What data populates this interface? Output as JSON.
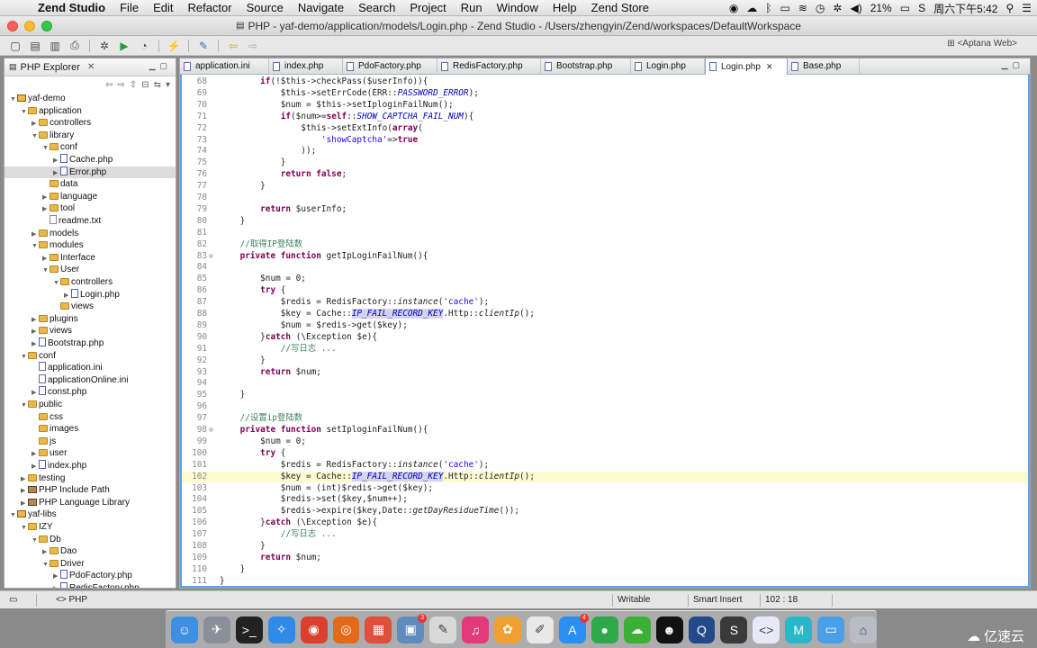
{
  "menubar": {
    "app": "Zend Studio",
    "items": [
      "File",
      "Edit",
      "Refactor",
      "Source",
      "Navigate",
      "Search",
      "Project",
      "Run",
      "Window",
      "Help",
      "Zend Store"
    ],
    "battery": "21%",
    "clock": "周六下午5:42"
  },
  "window": {
    "title": "PHP - yaf-demo/application/models/Login.php - Zend Studio - /Users/zhengyin/Zend/workspaces/DefaultWorkspace"
  },
  "toolbar": {
    "perspective": "<Aptana Web>"
  },
  "explorer": {
    "title": "PHP Explorer",
    "tree": [
      {
        "label": "yaf-demo",
        "depth": 0,
        "icon": "proj",
        "open": true
      },
      {
        "label": "application",
        "depth": 1,
        "icon": "folder",
        "open": true
      },
      {
        "label": "controllers",
        "depth": 2,
        "icon": "folder",
        "open": false
      },
      {
        "label": "library",
        "depth": 2,
        "icon": "folder",
        "open": true
      },
      {
        "label": "conf",
        "depth": 3,
        "icon": "folder",
        "open": true
      },
      {
        "label": "Cache.php",
        "depth": 4,
        "icon": "php",
        "open": false
      },
      {
        "label": "Error.php",
        "depth": 4,
        "icon": "php",
        "open": false,
        "selected": true
      },
      {
        "label": "data",
        "depth": 3,
        "icon": "folder",
        "open": null
      },
      {
        "label": "language",
        "depth": 3,
        "icon": "folder",
        "open": false
      },
      {
        "label": "tool",
        "depth": 3,
        "icon": "folder",
        "open": false
      },
      {
        "label": "readme.txt",
        "depth": 3,
        "icon": "txt",
        "open": null
      },
      {
        "label": "models",
        "depth": 2,
        "icon": "folder",
        "open": false
      },
      {
        "label": "modules",
        "depth": 2,
        "icon": "folder",
        "open": true
      },
      {
        "label": "Interface",
        "depth": 3,
        "icon": "folder",
        "open": false
      },
      {
        "label": "User",
        "depth": 3,
        "icon": "folder",
        "open": true
      },
      {
        "label": "controllers",
        "depth": 4,
        "icon": "folder",
        "open": true
      },
      {
        "label": "Login.php",
        "depth": 5,
        "icon": "php",
        "open": false
      },
      {
        "label": "views",
        "depth": 4,
        "icon": "folder",
        "open": null
      },
      {
        "label": "plugins",
        "depth": 2,
        "icon": "folder",
        "open": false
      },
      {
        "label": "views",
        "depth": 2,
        "icon": "folder",
        "open": false
      },
      {
        "label": "Bootstrap.php",
        "depth": 2,
        "icon": "php",
        "open": false
      },
      {
        "label": "conf",
        "depth": 1,
        "icon": "folder",
        "open": true
      },
      {
        "label": "application.ini",
        "depth": 2,
        "icon": "file",
        "open": null
      },
      {
        "label": "applicationOnline.ini",
        "depth": 2,
        "icon": "file",
        "open": null
      },
      {
        "label": "const.php",
        "depth": 2,
        "icon": "php",
        "open": false
      },
      {
        "label": "public",
        "depth": 1,
        "icon": "folder",
        "open": true
      },
      {
        "label": "css",
        "depth": 2,
        "icon": "folder",
        "open": null
      },
      {
        "label": "images",
        "depth": 2,
        "icon": "folder",
        "open": null
      },
      {
        "label": "js",
        "depth": 2,
        "icon": "folder",
        "open": null
      },
      {
        "label": "user",
        "depth": 2,
        "icon": "folder",
        "open": false
      },
      {
        "label": "index.php",
        "depth": 2,
        "icon": "php",
        "open": false
      },
      {
        "label": "testing",
        "depth": 1,
        "icon": "folder",
        "open": false
      },
      {
        "label": "PHP Include Path",
        "depth": 1,
        "icon": "lib",
        "open": false
      },
      {
        "label": "PHP Language Library",
        "depth": 1,
        "icon": "lib",
        "open": false
      },
      {
        "label": "yaf-libs",
        "depth": 0,
        "icon": "proj",
        "open": true
      },
      {
        "label": "IZY",
        "depth": 1,
        "icon": "folder",
        "open": true
      },
      {
        "label": "Db",
        "depth": 2,
        "icon": "folder",
        "open": true
      },
      {
        "label": "Dao",
        "depth": 3,
        "icon": "folder",
        "open": false
      },
      {
        "label": "Driver",
        "depth": 3,
        "icon": "folder",
        "open": true
      },
      {
        "label": "PdoFactory.php",
        "depth": 4,
        "icon": "php",
        "open": false
      },
      {
        "label": "RedisFactory.php",
        "depth": 4,
        "icon": "php",
        "open": false
      }
    ]
  },
  "tabs": [
    {
      "label": "application.ini",
      "active": false
    },
    {
      "label": "index.php",
      "active": false
    },
    {
      "label": "PdoFactory.php",
      "active": false
    },
    {
      "label": "RedisFactory.php",
      "active": false
    },
    {
      "label": "Bootstrap.php",
      "active": false
    },
    {
      "label": "Login.php",
      "active": false
    },
    {
      "label": "Login.php",
      "active": true
    },
    {
      "label": "Base.php",
      "active": false
    }
  ],
  "code": [
    {
      "n": "68",
      "fold": "",
      "t": [
        [
          "",
          "        "
        ],
        [
          "k",
          "if"
        ],
        [
          "",
          "(!$this->checkPass($userInfo)){"
        ]
      ]
    },
    {
      "n": "69",
      "fold": "",
      "t": [
        [
          "",
          "            $this->setErrCode(ERR::"
        ],
        [
          "co",
          "PASSWORD_ERROR"
        ],
        [
          "",
          ");"
        ]
      ]
    },
    {
      "n": "70",
      "fold": "",
      "t": [
        [
          "",
          "            $num = $this->setIploginFailNum();"
        ]
      ]
    },
    {
      "n": "71",
      "fold": "",
      "t": [
        [
          "",
          "            "
        ],
        [
          "k",
          "if"
        ],
        [
          "",
          "($num>="
        ],
        [
          "k",
          "self"
        ],
        [
          "",
          "::"
        ],
        [
          "co",
          "SHOW_CAPTCHA_FAIL_NUM"
        ],
        [
          "",
          "){"
        ]
      ]
    },
    {
      "n": "72",
      "fold": "",
      "t": [
        [
          "",
          "                $this->setExtInfo("
        ],
        [
          "k",
          "array"
        ],
        [
          "",
          "("
        ]
      ]
    },
    {
      "n": "73",
      "fold": "",
      "t": [
        [
          "",
          "                    "
        ],
        [
          "s",
          "'showCaptcha'"
        ],
        [
          "",
          "=>"
        ],
        [
          "k",
          "true"
        ]
      ]
    },
    {
      "n": "74",
      "fold": "",
      "t": [
        [
          "",
          "                ));"
        ]
      ]
    },
    {
      "n": "75",
      "fold": "",
      "t": [
        [
          "",
          "            }"
        ]
      ]
    },
    {
      "n": "76",
      "fold": "",
      "t": [
        [
          "",
          "            "
        ],
        [
          "k",
          "return false"
        ],
        [
          "",
          ";"
        ]
      ]
    },
    {
      "n": "77",
      "fold": "",
      "t": [
        [
          "",
          "        }"
        ]
      ]
    },
    {
      "n": "78",
      "fold": "",
      "t": [
        [
          "",
          ""
        ]
      ]
    },
    {
      "n": "79",
      "fold": "",
      "t": [
        [
          "",
          "        "
        ],
        [
          "k",
          "return"
        ],
        [
          "",
          " $userInfo;"
        ]
      ]
    },
    {
      "n": "80",
      "fold": "",
      "t": [
        [
          "",
          "    }"
        ]
      ]
    },
    {
      "n": "81",
      "fold": "",
      "t": [
        [
          "",
          ""
        ]
      ]
    },
    {
      "n": "82",
      "fold": "",
      "t": [
        [
          "",
          "    "
        ],
        [
          "c",
          "//取得IP登陆数"
        ]
      ]
    },
    {
      "n": "83",
      "fold": "⊖",
      "t": [
        [
          "",
          "    "
        ],
        [
          "k",
          "private function"
        ],
        [
          "",
          " getIpLoginFailNum(){"
        ]
      ]
    },
    {
      "n": "84",
      "fold": "",
      "t": [
        [
          "",
          ""
        ]
      ]
    },
    {
      "n": "85",
      "fold": "",
      "t": [
        [
          "",
          "        $num = 0;"
        ]
      ]
    },
    {
      "n": "86",
      "fold": "",
      "t": [
        [
          "",
          "        "
        ],
        [
          "k",
          "try"
        ],
        [
          "",
          " {"
        ]
      ]
    },
    {
      "n": "87",
      "fold": "",
      "t": [
        [
          "",
          "            $redis = RedisFactory::"
        ],
        [
          "m",
          "instance"
        ],
        [
          "",
          "("
        ],
        [
          "s",
          "'cache'"
        ],
        [
          "",
          ");"
        ]
      ]
    },
    {
      "n": "88",
      "fold": "",
      "t": [
        [
          "",
          "            $key = Cache::"
        ],
        [
          "co hi",
          "IP_FAIL_RECORD_KEY"
        ],
        [
          "",
          ".Http::"
        ],
        [
          "m",
          "clientIp"
        ],
        [
          "",
          "();"
        ]
      ]
    },
    {
      "n": "89",
      "fold": "",
      "t": [
        [
          "",
          "            $num = $redis->get($key);"
        ]
      ]
    },
    {
      "n": "90",
      "fold": "",
      "t": [
        [
          "",
          "        }"
        ],
        [
          "k",
          "catch"
        ],
        [
          "",
          " (\\Exception $e){"
        ]
      ]
    },
    {
      "n": "91",
      "fold": "",
      "t": [
        [
          "",
          "            "
        ],
        [
          "c",
          "//写日志 ..."
        ]
      ]
    },
    {
      "n": "92",
      "fold": "",
      "t": [
        [
          "",
          "        }"
        ]
      ]
    },
    {
      "n": "93",
      "fold": "",
      "t": [
        [
          "",
          "        "
        ],
        [
          "k",
          "return"
        ],
        [
          "",
          " $num;"
        ]
      ]
    },
    {
      "n": "94",
      "fold": "",
      "t": [
        [
          "",
          ""
        ]
      ]
    },
    {
      "n": "95",
      "fold": "",
      "t": [
        [
          "",
          "    }"
        ]
      ]
    },
    {
      "n": "96",
      "fold": "",
      "t": [
        [
          "",
          ""
        ]
      ]
    },
    {
      "n": "97",
      "fold": "",
      "t": [
        [
          "",
          "    "
        ],
        [
          "c",
          "//设置ip登陆数"
        ]
      ]
    },
    {
      "n": "98",
      "fold": "⊖",
      "t": [
        [
          "",
          "    "
        ],
        [
          "k",
          "private function"
        ],
        [
          "",
          " setIploginFailNum(){"
        ]
      ]
    },
    {
      "n": "99",
      "fold": "",
      "t": [
        [
          "",
          "        $num = 0;"
        ]
      ]
    },
    {
      "n": "100",
      "fold": "",
      "t": [
        [
          "",
          "        "
        ],
        [
          "k",
          "try"
        ],
        [
          "",
          " {"
        ]
      ]
    },
    {
      "n": "101",
      "fold": "",
      "t": [
        [
          "",
          "            $redis = RedisFactory::"
        ],
        [
          "m",
          "instance"
        ],
        [
          "",
          "("
        ],
        [
          "s",
          "'cache'"
        ],
        [
          "",
          ");"
        ]
      ]
    },
    {
      "n": "102",
      "fold": "",
      "hl": true,
      "t": [
        [
          "",
          "            $key = Cache::"
        ],
        [
          "co hi",
          "IP_FAIL_RECORD_KEY"
        ],
        [
          "",
          ".Http::"
        ],
        [
          "m",
          "clientIp"
        ],
        [
          "",
          "();"
        ]
      ]
    },
    {
      "n": "103",
      "fold": "",
      "t": [
        [
          "",
          "            $num = (int)$redis->get($key);"
        ]
      ]
    },
    {
      "n": "104",
      "fold": "",
      "t": [
        [
          "",
          "            $redis->set($key,$num++);"
        ]
      ]
    },
    {
      "n": "105",
      "fold": "",
      "t": [
        [
          "",
          "            $redis->expire($key,Date::"
        ],
        [
          "m",
          "getDayResidueTime"
        ],
        [
          "",
          "());"
        ]
      ]
    },
    {
      "n": "106",
      "fold": "",
      "t": [
        [
          "",
          "        }"
        ],
        [
          "k",
          "catch"
        ],
        [
          "",
          " (\\Exception $e){"
        ]
      ]
    },
    {
      "n": "107",
      "fold": "",
      "t": [
        [
          "",
          "            "
        ],
        [
          "c",
          "//写日志 ..."
        ]
      ]
    },
    {
      "n": "108",
      "fold": "",
      "t": [
        [
          "",
          "        }"
        ]
      ]
    },
    {
      "n": "109",
      "fold": "",
      "t": [
        [
          "",
          "        "
        ],
        [
          "k",
          "return"
        ],
        [
          "",
          " $num;"
        ]
      ]
    },
    {
      "n": "110",
      "fold": "",
      "t": [
        [
          "",
          "    }"
        ]
      ]
    },
    {
      "n": "111",
      "fold": "",
      "t": [
        [
          "",
          "}"
        ]
      ]
    }
  ],
  "status": {
    "breadcrumb": "<> PHP",
    "writable": "Writable",
    "insert_mode": "Smart Insert",
    "position": "102 : 18"
  },
  "dock": {
    "apps": [
      {
        "name": "finder-icon",
        "glyph": "☺",
        "color": "#3d8fe0"
      },
      {
        "name": "launchpad-icon",
        "glyph": "✈",
        "color": "#8a8f99"
      },
      {
        "name": "terminal-icon",
        "glyph": ">_",
        "color": "#222222"
      },
      {
        "name": "safari-icon",
        "glyph": "✧",
        "color": "#2f8ae8"
      },
      {
        "name": "chrome-icon",
        "glyph": "◉",
        "color": "#d9412e"
      },
      {
        "name": "firefox-icon",
        "glyph": "◎",
        "color": "#e36a1a"
      },
      {
        "name": "app-grid-icon",
        "glyph": "▦",
        "color": "#e04e3c"
      },
      {
        "name": "preview-icon",
        "glyph": "▣",
        "color": "#5f8bbd",
        "badge": "3"
      },
      {
        "name": "notes-icon",
        "glyph": "✎",
        "color": "#d8d8d8"
      },
      {
        "name": "itunes-icon",
        "glyph": "♫",
        "color": "#e43a7a"
      },
      {
        "name": "photos-icon",
        "glyph": "✿",
        "color": "#f0a030"
      },
      {
        "name": "textedit-icon",
        "glyph": "✐",
        "color": "#e8e8e8"
      },
      {
        "name": "app-store-icon",
        "glyph": "A",
        "color": "#2a8ff0",
        "badge": "4"
      },
      {
        "name": "qq-browser-icon",
        "glyph": "●",
        "color": "#2fa84a"
      },
      {
        "name": "wechat-icon",
        "glyph": "☁",
        "color": "#3cb035"
      },
      {
        "name": "qq-icon",
        "glyph": "☻",
        "color": "#111111"
      },
      {
        "name": "quicktime-icon",
        "glyph": "Q",
        "color": "#224a88"
      },
      {
        "name": "sublime-icon",
        "glyph": "S",
        "color": "#3a3a3a"
      },
      {
        "name": "zend-studio-icon",
        "glyph": "<>",
        "color": "#e8e8f8"
      },
      {
        "name": "markdown-icon",
        "glyph": "M",
        "color": "#2ab8c8"
      },
      {
        "name": "folder-icon",
        "glyph": "▭",
        "color": "#4aa0e8"
      },
      {
        "name": "trash-icon",
        "glyph": "⌂",
        "color": "#b8bcc4"
      }
    ]
  },
  "watermark": {
    "text": "亿速云"
  },
  "colors": {
    "accent": "#5ba2e6",
    "keyword": "#7f0055",
    "string": "#2a00ff",
    "comment": "#3f7f5f",
    "constant": "#0000c0"
  }
}
